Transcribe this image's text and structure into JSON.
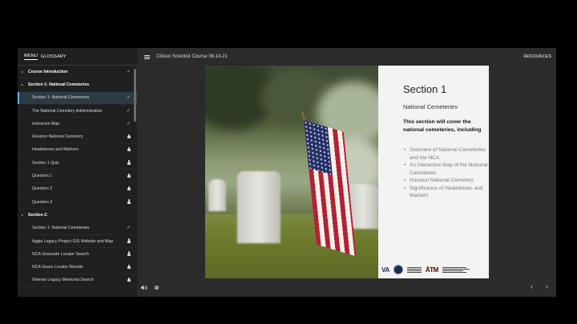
{
  "sidebar": {
    "tabs": [
      "MENU",
      "GLOSSARY"
    ],
    "sections": [
      {
        "label": "Course Introduction",
        "status": "check",
        "items": []
      },
      {
        "label": "Section 1: National Cemeteries",
        "status": "",
        "items": [
          {
            "label": "Section 1: National Cemeteries",
            "status": "check"
          },
          {
            "label": "The National Cemetery Administration",
            "status": "check"
          },
          {
            "label": "Interacive Map",
            "status": "check"
          },
          {
            "label": "Houston National Cemetery",
            "status": "lock"
          },
          {
            "label": "Headstones and Markers",
            "status": "lock"
          },
          {
            "label": "Section 1 Quiz",
            "status": "lock"
          },
          {
            "label": "Question 1",
            "status": "lock"
          },
          {
            "label": "Question 2",
            "status": "lock"
          },
          {
            "label": "Question 3",
            "status": "lock"
          }
        ]
      },
      {
        "label": "Section 2:",
        "status": "",
        "items": [
          {
            "label": "Section 1: National Cemeteries",
            "status": "check"
          },
          {
            "label": "Aggie Legacy Project GIS Website and Map",
            "status": "lock"
          },
          {
            "label": "NCA Gravesite Locator Search",
            "status": "lock"
          },
          {
            "label": "NCA Grave Locator Results",
            "status": "lock"
          },
          {
            "label": "Veteran Legacy Memorial Search",
            "status": "lock"
          }
        ]
      }
    ]
  },
  "header": {
    "course_title": "Citizen Scientist Course 06.14.21",
    "resources_label": "RESOURCES"
  },
  "slide": {
    "title": "Section 1",
    "subtitle": "National Cemeteries",
    "intro": "This section will cover the national cemeteries, including",
    "bullets": [
      "Overview of National Cemeteries and the NCA",
      "An interactive Map of the National Cemeteries",
      "Houston National Cemetery",
      "Significance of Headstones and Markers"
    ],
    "logo_text": "VA"
  },
  "icons": {
    "check": "✓",
    "prev": "‹",
    "next": "›"
  },
  "colors": {
    "accent": "#5db3e6",
    "sidebar_bg": "#1f1f1f",
    "player_bg": "#2b2b2b"
  }
}
